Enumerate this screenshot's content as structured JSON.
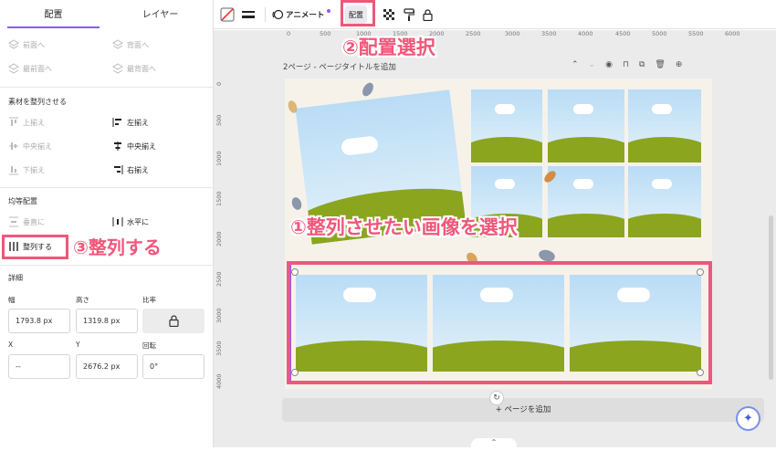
{
  "panel": {
    "tabs": [
      "配置",
      "レイヤー"
    ],
    "order": {
      "forward": "前面へ",
      "backward": "背面へ",
      "to_front": "最前面へ",
      "to_back": "最背面へ"
    },
    "align_section": {
      "title": "素材を整列させる",
      "top": "上揃え",
      "left": "左揃え",
      "middle": "中央揃え",
      "center": "中央揃え",
      "bottom": "下揃え",
      "right": "右揃え"
    },
    "spacing_section": {
      "title": "均等配置",
      "vertical": "垂直に",
      "horizontal": "水平に",
      "tidy": "整列する"
    },
    "details": {
      "title": "詳細",
      "width_label": "幅",
      "width_value": "1793.8 px",
      "height_label": "高さ",
      "height_value": "1319.8 px",
      "ratio_label": "比率",
      "x_label": "X",
      "x_value": "--",
      "y_label": "Y",
      "y_value": "2676.2 px",
      "rotation_label": "回転",
      "rotation_value": "0°"
    }
  },
  "toolbar": {
    "animate": "アニメート",
    "arrange": "配置"
  },
  "ruler": {
    "top": [
      "0",
      "500",
      "1000",
      "1500",
      "2000",
      "2500",
      "3000",
      "3500",
      "4000",
      "4500",
      "5000",
      "5500",
      "6000"
    ],
    "left": [
      "0",
      "500",
      "1000",
      "1500",
      "2000",
      "2500",
      "3000",
      "3500",
      "4000"
    ]
  },
  "canvas": {
    "page_title": "2ページ - ページタイトルを追加",
    "add_page": "+ ページを追加"
  },
  "annotations": {
    "step1": "①整列させたい画像を選択",
    "step2": "②配置選択",
    "step3": "③整列する"
  },
  "colors": {
    "highlight": "#f0577a",
    "accent": "#8b5cf6"
  }
}
